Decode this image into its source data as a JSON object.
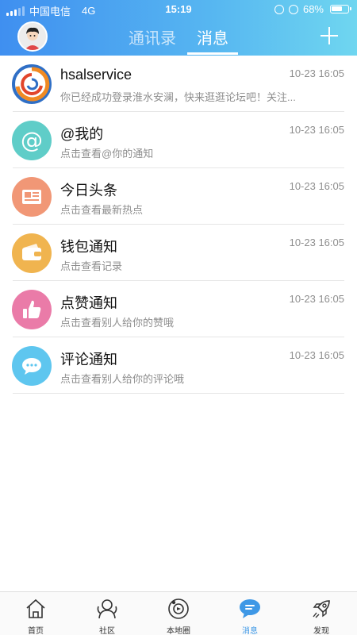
{
  "status_bar": {
    "carrier": "中国电信",
    "network": "4G",
    "time": "15:19",
    "battery": "68%",
    "battery_level": 0.68
  },
  "header": {
    "tabs": [
      {
        "label": "通讯录",
        "active": false
      },
      {
        "label": "消息",
        "active": true
      }
    ],
    "add_icon": "plus-icon",
    "avatar_icon": "avatar"
  },
  "messages": [
    {
      "title": "hsalservice",
      "subtitle": "你已经成功登录淮水安澜，快来逛逛论坛吧！关注...",
      "time": "10-23 16:05",
      "icon": "hsalservice-logo-icon"
    },
    {
      "title": "@我的",
      "subtitle": "点击查看@你的通知",
      "time": "10-23 16:05",
      "icon": "at-icon"
    },
    {
      "title": "今日头条",
      "subtitle": "点击查看最新热点",
      "time": "10-23 16:05",
      "icon": "newspaper-icon"
    },
    {
      "title": "钱包通知",
      "subtitle": "点击查看记录",
      "time": "10-23 16:05",
      "icon": "wallet-icon"
    },
    {
      "title": "点赞通知",
      "subtitle": "点击查看别人给你的赞哦",
      "time": "10-23 16:05",
      "icon": "thumbs-up-icon"
    },
    {
      "title": "评论通知",
      "subtitle": "点击查看别人给你的评论哦",
      "time": "10-23 16:05",
      "icon": "comment-icon"
    }
  ],
  "tabbar": [
    {
      "label": "首页",
      "icon": "home-icon",
      "active": false
    },
    {
      "label": "社区",
      "icon": "community-icon",
      "active": false
    },
    {
      "label": "本地圈",
      "icon": "local-circle-icon",
      "active": false
    },
    {
      "label": "消息",
      "icon": "message-icon",
      "active": true
    },
    {
      "label": "发现",
      "icon": "rocket-icon",
      "active": false
    }
  ],
  "colors": {
    "header_start": "#3f8ff0",
    "header_end": "#6fd6f0",
    "accent": "#3e98e6",
    "at_icon": "#5fcdc8",
    "news_icon": "#f19776",
    "wallet_icon": "#f0b44f",
    "like_icon": "#ea7ba8",
    "comment_icon": "#5ec6ef"
  }
}
